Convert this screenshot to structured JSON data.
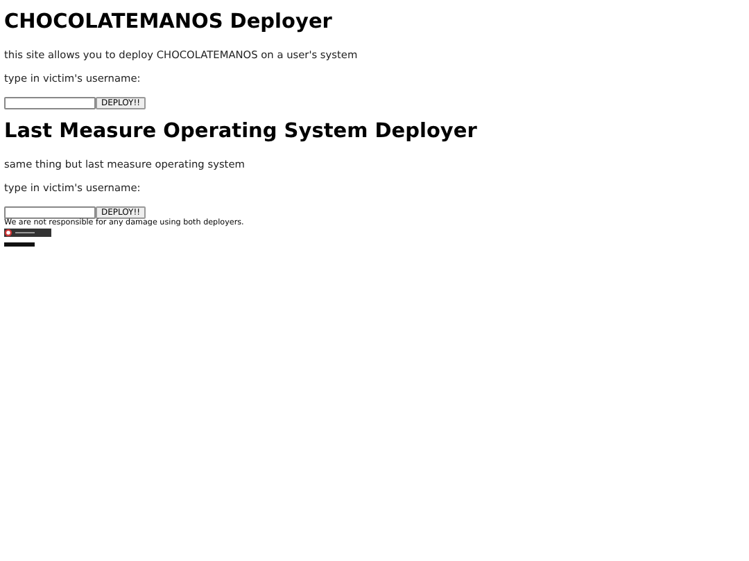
{
  "sections": [
    {
      "heading": "CHOCOLATEMANOS Deployer",
      "description": "this site allows you to deploy CHOCOLATEMANOS on a user's system",
      "prompt": "type in victim's username:",
      "button": "DEPLOY!!"
    },
    {
      "heading": "Last Measure Operating System Deployer",
      "description": "same thing but last measure operating system",
      "prompt": "type in victim's username:",
      "button": "DEPLOY!!"
    }
  ],
  "disclaimer": "We are not responsible for any damage using both deployers."
}
